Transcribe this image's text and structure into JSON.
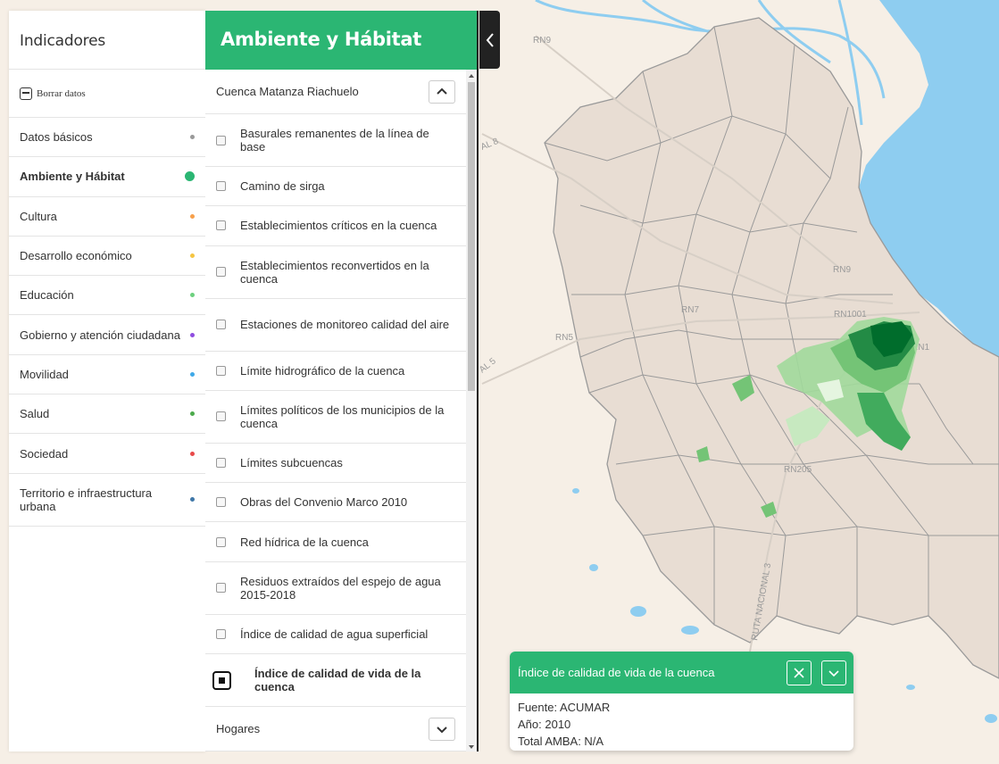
{
  "left_panel": {
    "title": "Indicadores",
    "clear_label": "Borrar datos",
    "categories": [
      {
        "label": "Datos básicos",
        "color": "#999999"
      },
      {
        "label": "Ambiente y Hábitat",
        "color": "#2bb673"
      },
      {
        "label": "Cultura",
        "color": "#f7a04b"
      },
      {
        "label": "Desarrollo económico",
        "color": "#f5c542"
      },
      {
        "label": "Educación",
        "color": "#6dd07f"
      },
      {
        "label": "Gobierno y atención ciudadana",
        "color": "#8f4de0"
      },
      {
        "label": "Movilidad",
        "color": "#3fa9e8"
      },
      {
        "label": "Salud",
        "color": "#4caa4c"
      },
      {
        "label": "Sociedad",
        "color": "#e84a4a"
      },
      {
        "label": "Territorio e infraestructura urbana",
        "color": "#3f77a8"
      }
    ]
  },
  "mid_panel": {
    "title": "Ambiente y Hábitat",
    "group_1": "Cuenca Matanza Riachuelo",
    "layers": [
      "Basurales remanentes de la línea de base",
      "Camino de sirga",
      "Establecimientos críticos en la cuenca",
      "Establecimientos reconvertidos en la cuenca",
      "Estaciones de monitoreo calidad del aire",
      "Límite hidrográfico de la cuenca",
      "Límites políticos de los municipios de la cuenca",
      "Límites subcuencas",
      "Obras del Convenio Marco 2010",
      "Red hídrica de la cuenca",
      "Residuos extraídos del espejo de agua 2015-2018",
      "Índice de calidad de agua superficial"
    ],
    "active_layer": "Índice de calidad de vida de la cuenca",
    "group_2": "Hogares"
  },
  "map": {
    "road_labels": [
      "RN9",
      "RN9",
      "RN7",
      "RN5",
      "RN1001",
      "RN1",
      "RN205",
      "RUTA NACIONAL 3",
      "AL 8",
      "AL 5"
    ],
    "water_color": "#8ecdf0",
    "land_color": "#f6efe6",
    "region_color": "#e8ddd3",
    "choropleth_colors": [
      "#e5f5e0",
      "#a1d99b",
      "#74c476",
      "#41ab5d",
      "#238b45",
      "#006d2c"
    ]
  },
  "legend": {
    "title": "Índice de calidad de vida de la cuenca",
    "source": "Fuente: ACUMAR",
    "year": "Año: 2010",
    "total": "Total AMBA: N/A"
  }
}
